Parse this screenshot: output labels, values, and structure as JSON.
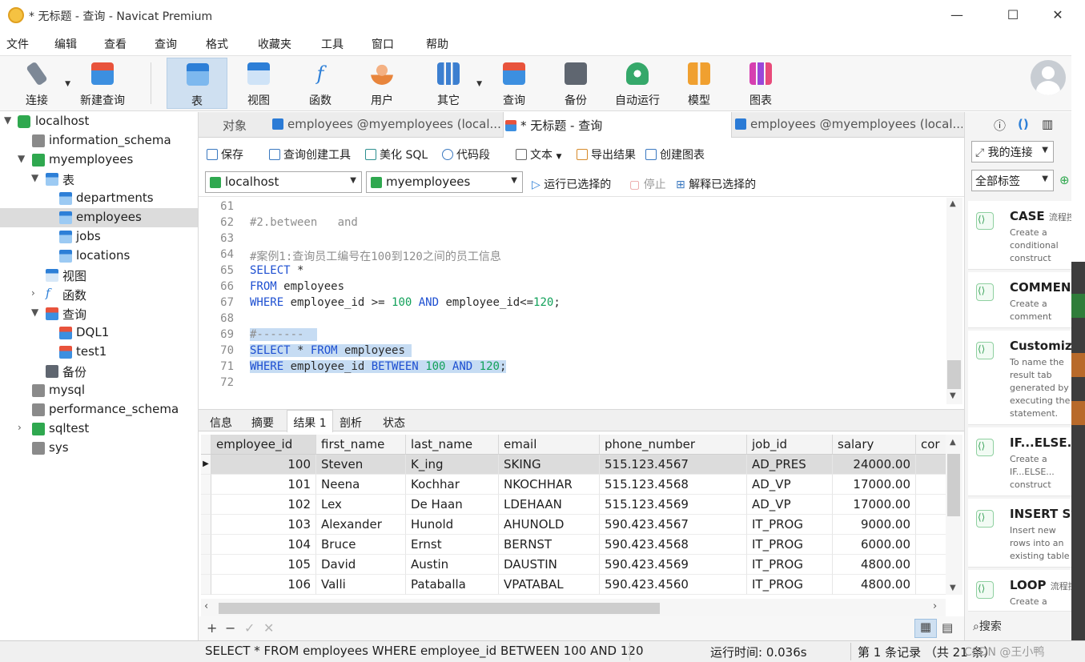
{
  "window": {
    "title": "* 无标题 - 查询 - Navicat Premium",
    "minimize": "—",
    "maximize": "☐",
    "close": "✕"
  },
  "menu": [
    "文件",
    "编辑",
    "查看",
    "查询",
    "格式",
    "收藏夹",
    "工具",
    "窗口",
    "帮助"
  ],
  "toolbar": {
    "connect": "连接",
    "new_query": "新建查询",
    "table": "表",
    "view": "视图",
    "function": "函数",
    "user": "用户",
    "other": "其它",
    "query": "查询",
    "backup": "备份",
    "automation": "自动运行",
    "model": "模型",
    "chart": "图表"
  },
  "tree": {
    "localhost": "localhost",
    "information_schema": "information_schema",
    "myemployees": "myemployees",
    "tables": "表",
    "departments": "departments",
    "employees": "employees",
    "jobs": "jobs",
    "locations": "locations",
    "views": "视图",
    "functions": "函数",
    "queries": "查询",
    "dql1": "DQL1",
    "test1": "test1",
    "backups": "备份",
    "mysql": "mysql",
    "performance_schema": "performance_schema",
    "sqltest": "sqltest",
    "sys": "sys"
  },
  "tabs": {
    "objects": "对象",
    "tab1": "employees @myemployees (local...",
    "tab2": "* 无标题 - 查询",
    "tab3": "employees @myemployees (local..."
  },
  "editor_toolbar": {
    "save": "保存",
    "query_builder": "查询创建工具",
    "beautify": "美化 SQL",
    "snippet": "代码段",
    "text": "文本",
    "export": "导出结果",
    "create_chart": "创建图表"
  },
  "conn_row": {
    "connection": "localhost",
    "database": "myemployees",
    "run_selected": "运行已选择的",
    "stop": "停止",
    "explain": "解释已选择的"
  },
  "editor": {
    "lines": [
      "61",
      "62",
      "63",
      "64",
      "65",
      "66",
      "67",
      "68",
      "69",
      "70",
      "71",
      "72"
    ],
    "l62": "#2.between   and",
    "l64": "#案例1:查询员工编号在100到120之间的员工信息",
    "l65_kw": "SELECT",
    "l65_rest": " *",
    "l66_kw": "FROM",
    "l66_rest": " employees",
    "l67_kw1": "WHERE",
    "l67_a": " employee_id >= ",
    "l67_n1": "100",
    "l67_kw2": " AND",
    "l67_b": " employee_id<=",
    "l67_n2": "120",
    "l67_end": ";",
    "l69": "#-------",
    "l70_kw1": "SELECT",
    "l70_a": " * ",
    "l70_kw2": "FROM",
    "l70_b": " employees",
    "l71_kw1": "WHERE",
    "l71_a": " employee_id ",
    "l71_kw2": "BETWEEN",
    "l71_sp": " ",
    "l71_n1": "100",
    "l71_kw3": " AND",
    "l71_sp2": " ",
    "l71_n2": "120",
    "l71_end": ";"
  },
  "result_tabs": [
    "信息",
    "摘要",
    "结果 1",
    "剖析",
    "状态"
  ],
  "grid": {
    "columns": [
      "employee_id",
      "first_name",
      "last_name",
      "email",
      "phone_number",
      "job_id",
      "salary",
      "cor"
    ],
    "rows": [
      [
        "100",
        "Steven",
        "K_ing",
        "SKING",
        "515.123.4567",
        "AD_PRES",
        "24000.00"
      ],
      [
        "101",
        "Neena",
        "Kochhar",
        "NKOCHHAR",
        "515.123.4568",
        "AD_VP",
        "17000.00"
      ],
      [
        "102",
        "Lex",
        "De Haan",
        "LDEHAAN",
        "515.123.4569",
        "AD_VP",
        "17000.00"
      ],
      [
        "103",
        "Alexander",
        "Hunold",
        "AHUNOLD",
        "590.423.4567",
        "IT_PROG",
        "9000.00"
      ],
      [
        "104",
        "Bruce",
        "Ernst",
        "BERNST",
        "590.423.4568",
        "IT_PROG",
        "6000.00"
      ],
      [
        "105",
        "David",
        "Austin",
        "DAUSTIN",
        "590.423.4569",
        "IT_PROG",
        "4800.00"
      ],
      [
        "106",
        "Valli",
        "Pataballa",
        "VPATABAL",
        "590.423.4560",
        "IT_PROG",
        "4800.00"
      ]
    ]
  },
  "grid_footer": {
    "add": "+",
    "remove": "−",
    "apply": "✓",
    "discard": "✕"
  },
  "status": {
    "sql": "SELECT * FROM employees WHERE employee_id BETWEEN 100 AND 120",
    "runtime": "运行时间: 0.036s",
    "records": "第 1 条记录 （共 21 条）",
    "watermark": "CSDN @王小鸭"
  },
  "right_panel": {
    "my_connections": "我的连接",
    "all_tags": "全部标签",
    "search": "搜索",
    "snippets": [
      {
        "title": "CASE",
        "tag": "流程控",
        "desc": "Create a conditional construct"
      },
      {
        "title": "COMMEN",
        "tag": "",
        "desc": "Create a comment"
      },
      {
        "title": "Customiz",
        "tag": "",
        "desc": "To name the result tab generated by executing the statement."
      },
      {
        "title": "IF...ELSE...",
        "tag": "",
        "desc": "Create a IF...ELSE... construct"
      },
      {
        "title": "INSERT Sy",
        "tag": "",
        "desc": "Insert new rows into an existing table"
      },
      {
        "title": "LOOP",
        "tag": "流程控",
        "desc": "Create a"
      }
    ]
  }
}
